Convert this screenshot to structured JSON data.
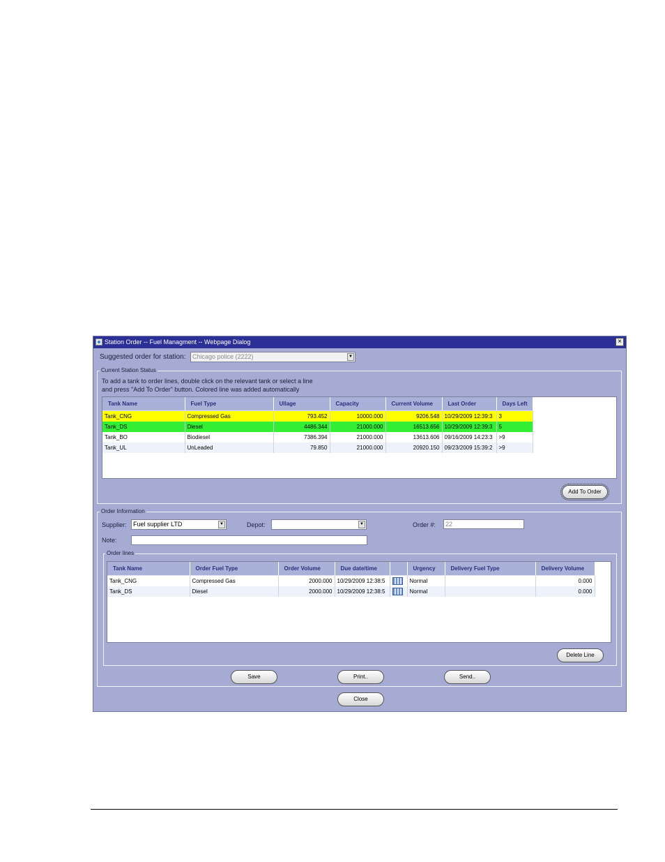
{
  "window": {
    "title": "Station Order -- Fuel Managment -- Webpage Dialog",
    "close_glyph": "×"
  },
  "station": {
    "label": "Suggested order for station:",
    "value": "Chicago police (2222)"
  },
  "status": {
    "legend": "Current Station Status",
    "instruction_line1": "To add a tank to order lines, double click on the relevant tank or select a line",
    "instruction_line2": "and press \"Add To Order\" button. Colored line was added automatically",
    "columns": [
      "Tank Name",
      "Fuel Type",
      "Ullage",
      "Capacity",
      "Current Volume",
      "Last Order",
      "Days Left"
    ],
    "rows": [
      {
        "tank": "Tank_CNG",
        "fuel": "Compressed Gas",
        "ullage": "793.452",
        "capacity": "10000.000",
        "current": "9206.548",
        "last_order": "10/29/2009 12:39:3",
        "days": "3"
      },
      {
        "tank": "Tank_DS",
        "fuel": "Diesel",
        "ullage": "4486.344",
        "capacity": "21000.000",
        "current": "16513.656",
        "last_order": "10/29/2009 12:39:3",
        "days": "5"
      },
      {
        "tank": "Tank_BO",
        "fuel": "Biodiesel",
        "ullage": "7386.394",
        "capacity": "21000.000",
        "current": "13613.606",
        "last_order": "09/16/2009 14:23:3",
        "days": ">9"
      },
      {
        "tank": "Tank_UL",
        "fuel": "UnLeaded",
        "ullage": "79.850",
        "capacity": "21000.000",
        "current": "20920.150",
        "last_order": "09/23/2009 15:39:2",
        "days": ">9"
      }
    ],
    "add_button": "Add To Order"
  },
  "order": {
    "legend": "Order Information",
    "supplier_label": "Supplier:",
    "supplier_value": "Fuel supplier LTD",
    "depot_label": "Depot:",
    "depot_value": "",
    "order_no_label": "Order #:",
    "order_no_value": "22",
    "note_label": "Note:",
    "note_value": "",
    "lines_legend": "Order lines",
    "columns": [
      "Tank Name",
      "Order Fuel Type",
      "Order Volume",
      "Due date/time",
      "",
      "Urgency",
      "Delivery Fuel Type",
      "Delivery Volume"
    ],
    "rows": [
      {
        "tank": "Tank_CNG",
        "fuel": "Compressed Gas",
        "volume": "2000.000",
        "due": "10/29/2009 12:38:5",
        "urgency": "Normal",
        "delivery_fuel": "",
        "delivery_volume": "0.000"
      },
      {
        "tank": "Tank_DS",
        "fuel": "Diesel",
        "volume": "2000.000",
        "due": "10/29/2009 12:38:5",
        "urgency": "Normal",
        "delivery_fuel": "",
        "delivery_volume": "0.000"
      }
    ],
    "delete_button": "Delete Line"
  },
  "actions": {
    "save": "Save",
    "print": "Print..",
    "send": "Send..",
    "close": "Close"
  },
  "icons": {
    "dropdown": "chevron-down-icon",
    "calendar": "calendar-icon",
    "app": "ie-icon"
  }
}
